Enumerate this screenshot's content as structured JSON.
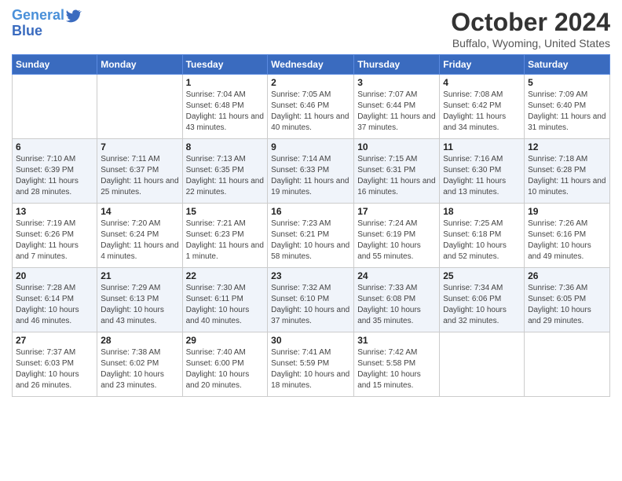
{
  "header": {
    "logo_line1": "General",
    "logo_line2": "Blue",
    "month_title": "October 2024",
    "location": "Buffalo, Wyoming, United States"
  },
  "weekdays": [
    "Sunday",
    "Monday",
    "Tuesday",
    "Wednesday",
    "Thursday",
    "Friday",
    "Saturday"
  ],
  "weeks": [
    [
      {
        "day": "",
        "detail": ""
      },
      {
        "day": "",
        "detail": ""
      },
      {
        "day": "1",
        "detail": "Sunrise: 7:04 AM\nSunset: 6:48 PM\nDaylight: 11 hours and 43 minutes."
      },
      {
        "day": "2",
        "detail": "Sunrise: 7:05 AM\nSunset: 6:46 PM\nDaylight: 11 hours and 40 minutes."
      },
      {
        "day": "3",
        "detail": "Sunrise: 7:07 AM\nSunset: 6:44 PM\nDaylight: 11 hours and 37 minutes."
      },
      {
        "day": "4",
        "detail": "Sunrise: 7:08 AM\nSunset: 6:42 PM\nDaylight: 11 hours and 34 minutes."
      },
      {
        "day": "5",
        "detail": "Sunrise: 7:09 AM\nSunset: 6:40 PM\nDaylight: 11 hours and 31 minutes."
      }
    ],
    [
      {
        "day": "6",
        "detail": "Sunrise: 7:10 AM\nSunset: 6:39 PM\nDaylight: 11 hours and 28 minutes."
      },
      {
        "day": "7",
        "detail": "Sunrise: 7:11 AM\nSunset: 6:37 PM\nDaylight: 11 hours and 25 minutes."
      },
      {
        "day": "8",
        "detail": "Sunrise: 7:13 AM\nSunset: 6:35 PM\nDaylight: 11 hours and 22 minutes."
      },
      {
        "day": "9",
        "detail": "Sunrise: 7:14 AM\nSunset: 6:33 PM\nDaylight: 11 hours and 19 minutes."
      },
      {
        "day": "10",
        "detail": "Sunrise: 7:15 AM\nSunset: 6:31 PM\nDaylight: 11 hours and 16 minutes."
      },
      {
        "day": "11",
        "detail": "Sunrise: 7:16 AM\nSunset: 6:30 PM\nDaylight: 11 hours and 13 minutes."
      },
      {
        "day": "12",
        "detail": "Sunrise: 7:18 AM\nSunset: 6:28 PM\nDaylight: 11 hours and 10 minutes."
      }
    ],
    [
      {
        "day": "13",
        "detail": "Sunrise: 7:19 AM\nSunset: 6:26 PM\nDaylight: 11 hours and 7 minutes."
      },
      {
        "day": "14",
        "detail": "Sunrise: 7:20 AM\nSunset: 6:24 PM\nDaylight: 11 hours and 4 minutes."
      },
      {
        "day": "15",
        "detail": "Sunrise: 7:21 AM\nSunset: 6:23 PM\nDaylight: 11 hours and 1 minute."
      },
      {
        "day": "16",
        "detail": "Sunrise: 7:23 AM\nSunset: 6:21 PM\nDaylight: 10 hours and 58 minutes."
      },
      {
        "day": "17",
        "detail": "Sunrise: 7:24 AM\nSunset: 6:19 PM\nDaylight: 10 hours and 55 minutes."
      },
      {
        "day": "18",
        "detail": "Sunrise: 7:25 AM\nSunset: 6:18 PM\nDaylight: 10 hours and 52 minutes."
      },
      {
        "day": "19",
        "detail": "Sunrise: 7:26 AM\nSunset: 6:16 PM\nDaylight: 10 hours and 49 minutes."
      }
    ],
    [
      {
        "day": "20",
        "detail": "Sunrise: 7:28 AM\nSunset: 6:14 PM\nDaylight: 10 hours and 46 minutes."
      },
      {
        "day": "21",
        "detail": "Sunrise: 7:29 AM\nSunset: 6:13 PM\nDaylight: 10 hours and 43 minutes."
      },
      {
        "day": "22",
        "detail": "Sunrise: 7:30 AM\nSunset: 6:11 PM\nDaylight: 10 hours and 40 minutes."
      },
      {
        "day": "23",
        "detail": "Sunrise: 7:32 AM\nSunset: 6:10 PM\nDaylight: 10 hours and 37 minutes."
      },
      {
        "day": "24",
        "detail": "Sunrise: 7:33 AM\nSunset: 6:08 PM\nDaylight: 10 hours and 35 minutes."
      },
      {
        "day": "25",
        "detail": "Sunrise: 7:34 AM\nSunset: 6:06 PM\nDaylight: 10 hours and 32 minutes."
      },
      {
        "day": "26",
        "detail": "Sunrise: 7:36 AM\nSunset: 6:05 PM\nDaylight: 10 hours and 29 minutes."
      }
    ],
    [
      {
        "day": "27",
        "detail": "Sunrise: 7:37 AM\nSunset: 6:03 PM\nDaylight: 10 hours and 26 minutes."
      },
      {
        "day": "28",
        "detail": "Sunrise: 7:38 AM\nSunset: 6:02 PM\nDaylight: 10 hours and 23 minutes."
      },
      {
        "day": "29",
        "detail": "Sunrise: 7:40 AM\nSunset: 6:00 PM\nDaylight: 10 hours and 20 minutes."
      },
      {
        "day": "30",
        "detail": "Sunrise: 7:41 AM\nSunset: 5:59 PM\nDaylight: 10 hours and 18 minutes."
      },
      {
        "day": "31",
        "detail": "Sunrise: 7:42 AM\nSunset: 5:58 PM\nDaylight: 10 hours and 15 minutes."
      },
      {
        "day": "",
        "detail": ""
      },
      {
        "day": "",
        "detail": ""
      }
    ]
  ]
}
